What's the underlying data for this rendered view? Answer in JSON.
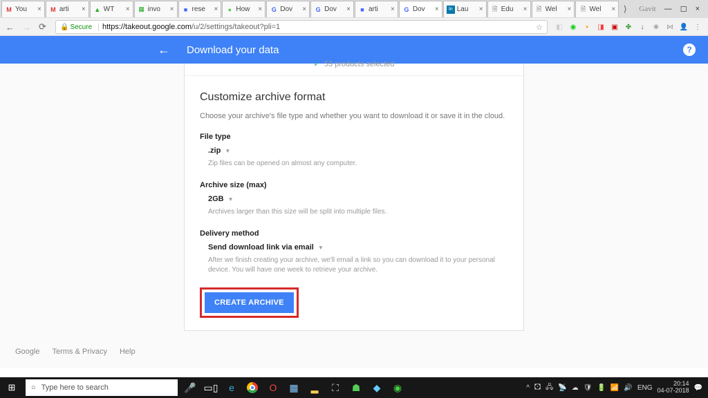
{
  "browser": {
    "tabs": [
      {
        "icon": "M",
        "icon_color": "#d33",
        "title": "You"
      },
      {
        "icon": "M",
        "icon_color": "#d33",
        "title": "arti"
      },
      {
        "icon": "▲",
        "icon_color": "#2a2",
        "title": "WT"
      },
      {
        "icon": "▦",
        "icon_color": "#2a2",
        "title": "invo"
      },
      {
        "icon": "■",
        "icon_color": "#46f",
        "title": "rese"
      },
      {
        "icon": "●",
        "icon_color": "#5c5",
        "title": "How"
      },
      {
        "icon": "G",
        "icon_color": "#46f",
        "title": "Dov"
      },
      {
        "icon": "G",
        "icon_color": "#46f",
        "title": "Dov"
      },
      {
        "icon": "■",
        "icon_color": "#46f",
        "title": "arti"
      },
      {
        "icon": "G",
        "icon_color": "#46f",
        "title": "Dov",
        "active": true
      },
      {
        "icon": "In",
        "icon_color": "#07a",
        "title": "Lau"
      },
      {
        "icon": "🗎",
        "icon_color": "#888",
        "title": "Edu"
      },
      {
        "icon": "🗎",
        "icon_color": "#888",
        "title": "Wel"
      },
      {
        "icon": "🗎",
        "icon_color": "#888",
        "title": "Wel"
      }
    ],
    "window": {
      "username": "Gavit",
      "minimize": "—",
      "maximize": "☐",
      "close": "×"
    },
    "secure_label": "Secure",
    "url_host": "https://takeout.google.com",
    "url_path": "/u/2/settings/takeout?pli=1"
  },
  "header": {
    "title": "Download your data"
  },
  "status_line": "53 products selected",
  "section": {
    "title": "Customize archive format",
    "desc": "Choose your archive's file type and whether you want to download it or save it in the cloud."
  },
  "file_type": {
    "label": "File type",
    "value": ".zip",
    "help": "Zip files can be opened on almost any computer."
  },
  "archive_size": {
    "label": "Archive size (max)",
    "value": "2GB",
    "help": "Archives larger than this size will be split into multiple files."
  },
  "delivery": {
    "label": "Delivery method",
    "value": "Send download link via email",
    "help": "After we finish creating your archive, we'll email a link so you can download it to your personal device. You will have one week to retrieve your archive."
  },
  "create_button": "CREATE ARCHIVE",
  "footer": {
    "google": "Google",
    "terms": "Terms & Privacy",
    "help": "Help"
  },
  "taskbar": {
    "search_placeholder": "Type here to search",
    "lang": "ENG",
    "time": "20:14",
    "date": "04-07-2018"
  }
}
